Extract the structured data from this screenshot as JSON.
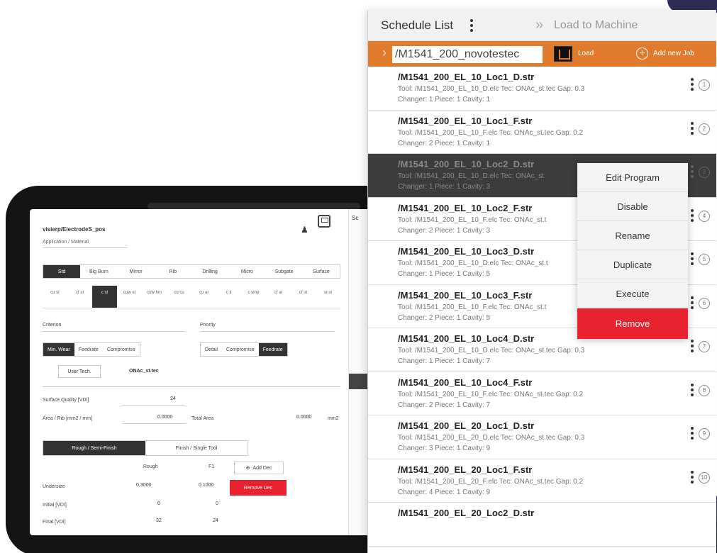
{
  "tablet": {
    "file_name": "visierp/ElectrodeS_pos",
    "app_material": "Application / Material",
    "operations": [
      "Std",
      "Big Burn",
      "Mirror",
      "Rib",
      "Drilling",
      "Micro",
      "Subgate",
      "Surface"
    ],
    "tools": [
      "cu st",
      "cf st",
      "c st",
      "cuw st",
      "cuw hm",
      "cu cu",
      "cu al",
      "c ti",
      "c smp",
      "cf al",
      "cf st",
      "st st"
    ],
    "criterion_label": "Criterion",
    "priority_label": "Priority",
    "criterion_options": [
      "Min. Wear",
      "Feedrate",
      "Compromise"
    ],
    "priority_options": [
      "Detail",
      "Compromise",
      "Feedrate"
    ],
    "user_tech": "User Tech.",
    "tech_name": "ONAc_st.tec",
    "surface_quality_label": "Surface Quality [VDI]",
    "surface_quality_value": "24",
    "area_label": "Area / Rib [mm2 / mm]",
    "area_value": "0.0000",
    "total_area_label": "Total Area",
    "total_area_value": "0.0000",
    "total_area_unit": "mm2",
    "rough_tabs": [
      "Rough / Semi-Finish",
      "Finish / Single Tool"
    ],
    "rough_label": "Rough",
    "f1_label": "F1",
    "add_dec": "Add Dec",
    "remove_dec": "Remove Dec",
    "undersize_label": "Undersize",
    "undersize_rough": "0.3000",
    "undersize_f1": "0.1000",
    "initial_label": "Initial [VDI]",
    "initial_rough": "0",
    "initial_f1": "0",
    "final_label": "Final [VDI]",
    "final_rough": "32",
    "final_f1": "24",
    "strip_label": "Sc"
  },
  "schedule": {
    "title": "Schedule List",
    "load_to_machine": "Load to Machine",
    "job_path": "/M1541_200_novotestec",
    "load_label": "Load",
    "add_job_label": "Add new Job",
    "items": [
      {
        "name": "/M1541_200_EL_10_Loc1_D.str",
        "line1": "Tool: /M1541_200_EL_10_D.elc  Tec: ONAc_st.tec  Gap: 0.3",
        "line2": "Changer: 1 Piece: 1 Cavity: 1",
        "num": "1"
      },
      {
        "name": "/M1541_200_EL_10_Loc1_F.str",
        "line1": "Tool: /M1541_200_EL_10_F.elc  Tec: ONAc_st.tec  Gap: 0.2",
        "line2": "Changer: 2 Piece: 1 Cavity: 1",
        "num": "2"
      },
      {
        "name": "/M1541_200_EL_10_Loc2_D.str",
        "line1": "Tool: /M1541_200_EL_10_D.elc  Tec: ONAc_st",
        "line2": "Changer: 1 Piece: 1 Cavity: 3",
        "num": "3"
      },
      {
        "name": "/M1541_200_EL_10_Loc2_F.str",
        "line1": "Tool: /M1541_200_EL_10_F.elc  Tec: ONAc_st.t",
        "line2": "Changer: 2 Piece: 1 Cavity: 3",
        "num": "4"
      },
      {
        "name": "/M1541_200_EL_10_Loc3_D.str",
        "line1": "Tool: /M1541_200_EL_10_D.elc  Tec: ONAc_st.t",
        "line2": "Changer: 1 Piece: 1 Cavity: 5",
        "num": "5"
      },
      {
        "name": "/M1541_200_EL_10_Loc3_F.str",
        "line1": "Tool: /M1541_200_EL_10_F.elc  Tec: ONAc_st.t",
        "line2": "Changer: 2 Piece: 1 Cavity: 5",
        "num": "6"
      },
      {
        "name": "/M1541_200_EL_10_Loc4_D.str",
        "line1": "Tool: /M1541_200_EL_10_D.elc  Tec: ONAc_st.tec  Gap: 0.3",
        "line2": "Changer: 1 Piece: 1 Cavity: 7",
        "num": "7"
      },
      {
        "name": "/M1541_200_EL_10_Loc4_F.str",
        "line1": "Tool: /M1541_200_EL_10_F.elc  Tec: ONAc_st.tec  Gap: 0.2",
        "line2": "Changer: 2 Piece: 1 Cavity: 7",
        "num": "8"
      },
      {
        "name": "/M1541_200_EL_20_Loc1_D.str",
        "line1": "Tool: /M1541_200_EL_20_D.elc  Tec: ONAc_st.tec  Gap: 0.3",
        "line2": "Changer: 3 Piece: 1 Cavity: 9",
        "num": "9"
      },
      {
        "name": "/M1541_200_EL_20_Loc1_F.str",
        "line1": "Tool: /M1541_200_EL_20_F.elc  Tec: ONAc_st.tec  Gap: 0.2",
        "line2": "Changer: 4 Piece: 1 Cavity: 9",
        "num": "10"
      },
      {
        "name": "/M1541_200_EL_20_Loc2_D.str",
        "line1": "",
        "line2": "",
        "num": ""
      }
    ]
  },
  "context_menu": {
    "items": [
      "Edit Program",
      "Disable",
      "Rename",
      "Duplicate",
      "Execute",
      "Remove"
    ]
  },
  "colors": {
    "accent_orange": "#e07b2d",
    "danger_red": "#e8232f",
    "selected_row": "#3c3c3c"
  }
}
